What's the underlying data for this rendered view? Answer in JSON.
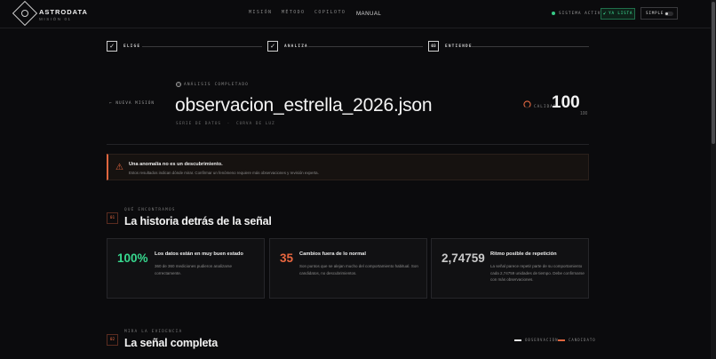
{
  "header": {
    "brand": "ASTRODATA",
    "brand_sub": "MISIÓN 01",
    "nav": [
      "MISIÓN",
      "MÉTODO",
      "COPILOTO",
      "MANUAL"
    ],
    "status": "SISTEMA ACTIVO",
    "ready_label": "YA LISTA",
    "mode_label": "SIMPLE"
  },
  "stepper": {
    "steps": [
      {
        "label": "ELIGE",
        "mark": "✓"
      },
      {
        "label": "ANALIZA",
        "mark": "✓"
      },
      {
        "label": "ENTIENDE",
        "mark": "03"
      }
    ]
  },
  "analysis": {
    "back_label": "NUEVA MISIÓN",
    "status_label": "ANÁLISIS COMPLETADO",
    "filename": "observacion_estrella_2026.json",
    "tag1": "SERIE DE DATOS",
    "tag2": "CURVA DE LUZ",
    "score_label": "CALIDAD",
    "score": "100",
    "score_max": "100",
    "score_fraction": 1.0
  },
  "alert": {
    "title": "Una anomalía no es un descubrimiento.",
    "text": "Estos resultados indican dónde mirar. Confirmar un fenómeno requiere más observaciones y revisión experta."
  },
  "section1": {
    "num": "01",
    "kicker": "QUÉ ENCONTRAMOS",
    "title": "La historia detrás de la señal"
  },
  "cards": [
    {
      "value": "100%",
      "title": "Los datos están en muy buen estado",
      "desc": "360 de 360 mediciones pudieron analizarse correctamente.",
      "color": "#37d98f"
    },
    {
      "value": "35",
      "title": "Cambios fuera de lo normal",
      "desc": "Son puntos que se alejan mucho del comportamiento habitual. Son candidatos, no descubrimientos.",
      "color": "#e8663f"
    },
    {
      "value": "2,74759",
      "title": "Ritmo posible de repetición",
      "desc": "La señal parece repetir parte de su comportamiento cada 2,74759 unidades de tiempo. Debe confirmarse con más observaciones.",
      "color": "#c9c9c9"
    }
  ],
  "section2": {
    "num": "02",
    "kicker": "MIRA LA EVIDENCIA",
    "title": "La señal completa"
  },
  "legend": [
    {
      "label": "OBSERVACIÓN",
      "color": "#e6e6e6"
    },
    {
      "label": "CANDIDATO",
      "color": "#e0663f"
    }
  ],
  "colors": {
    "accent": "#e0663f",
    "success": "#37d98f"
  }
}
